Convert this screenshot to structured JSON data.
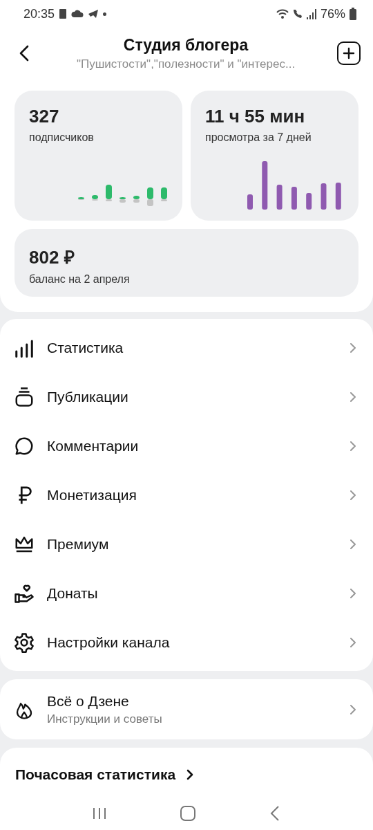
{
  "status_bar": {
    "time": "20:35",
    "battery": "76%"
  },
  "header": {
    "title": "Студия блогера",
    "subtitle": "\"Пушистости\",\"полезности\" и \"интерес..."
  },
  "stats": [
    {
      "value": "327",
      "label": "подписчиков",
      "kind": "subscribers"
    },
    {
      "value": "11 ч 55 мин",
      "label": "просмотра за 7 дней",
      "kind": "views"
    },
    {
      "value": "802 ₽",
      "label": "баланс на 2 апреля",
      "kind": "balance"
    }
  ],
  "menu": [
    {
      "label": "Статистика"
    },
    {
      "label": "Публикации"
    },
    {
      "label": "Комментарии"
    },
    {
      "label": "Монетизация"
    },
    {
      "label": "Премиум"
    },
    {
      "label": "Донаты"
    },
    {
      "label": "Настройки канала"
    }
  ],
  "about": {
    "title": "Всё о Дзене",
    "subtitle": "Инструкции и советы"
  },
  "hourly": {
    "title": "Почасовая статистика"
  }
}
